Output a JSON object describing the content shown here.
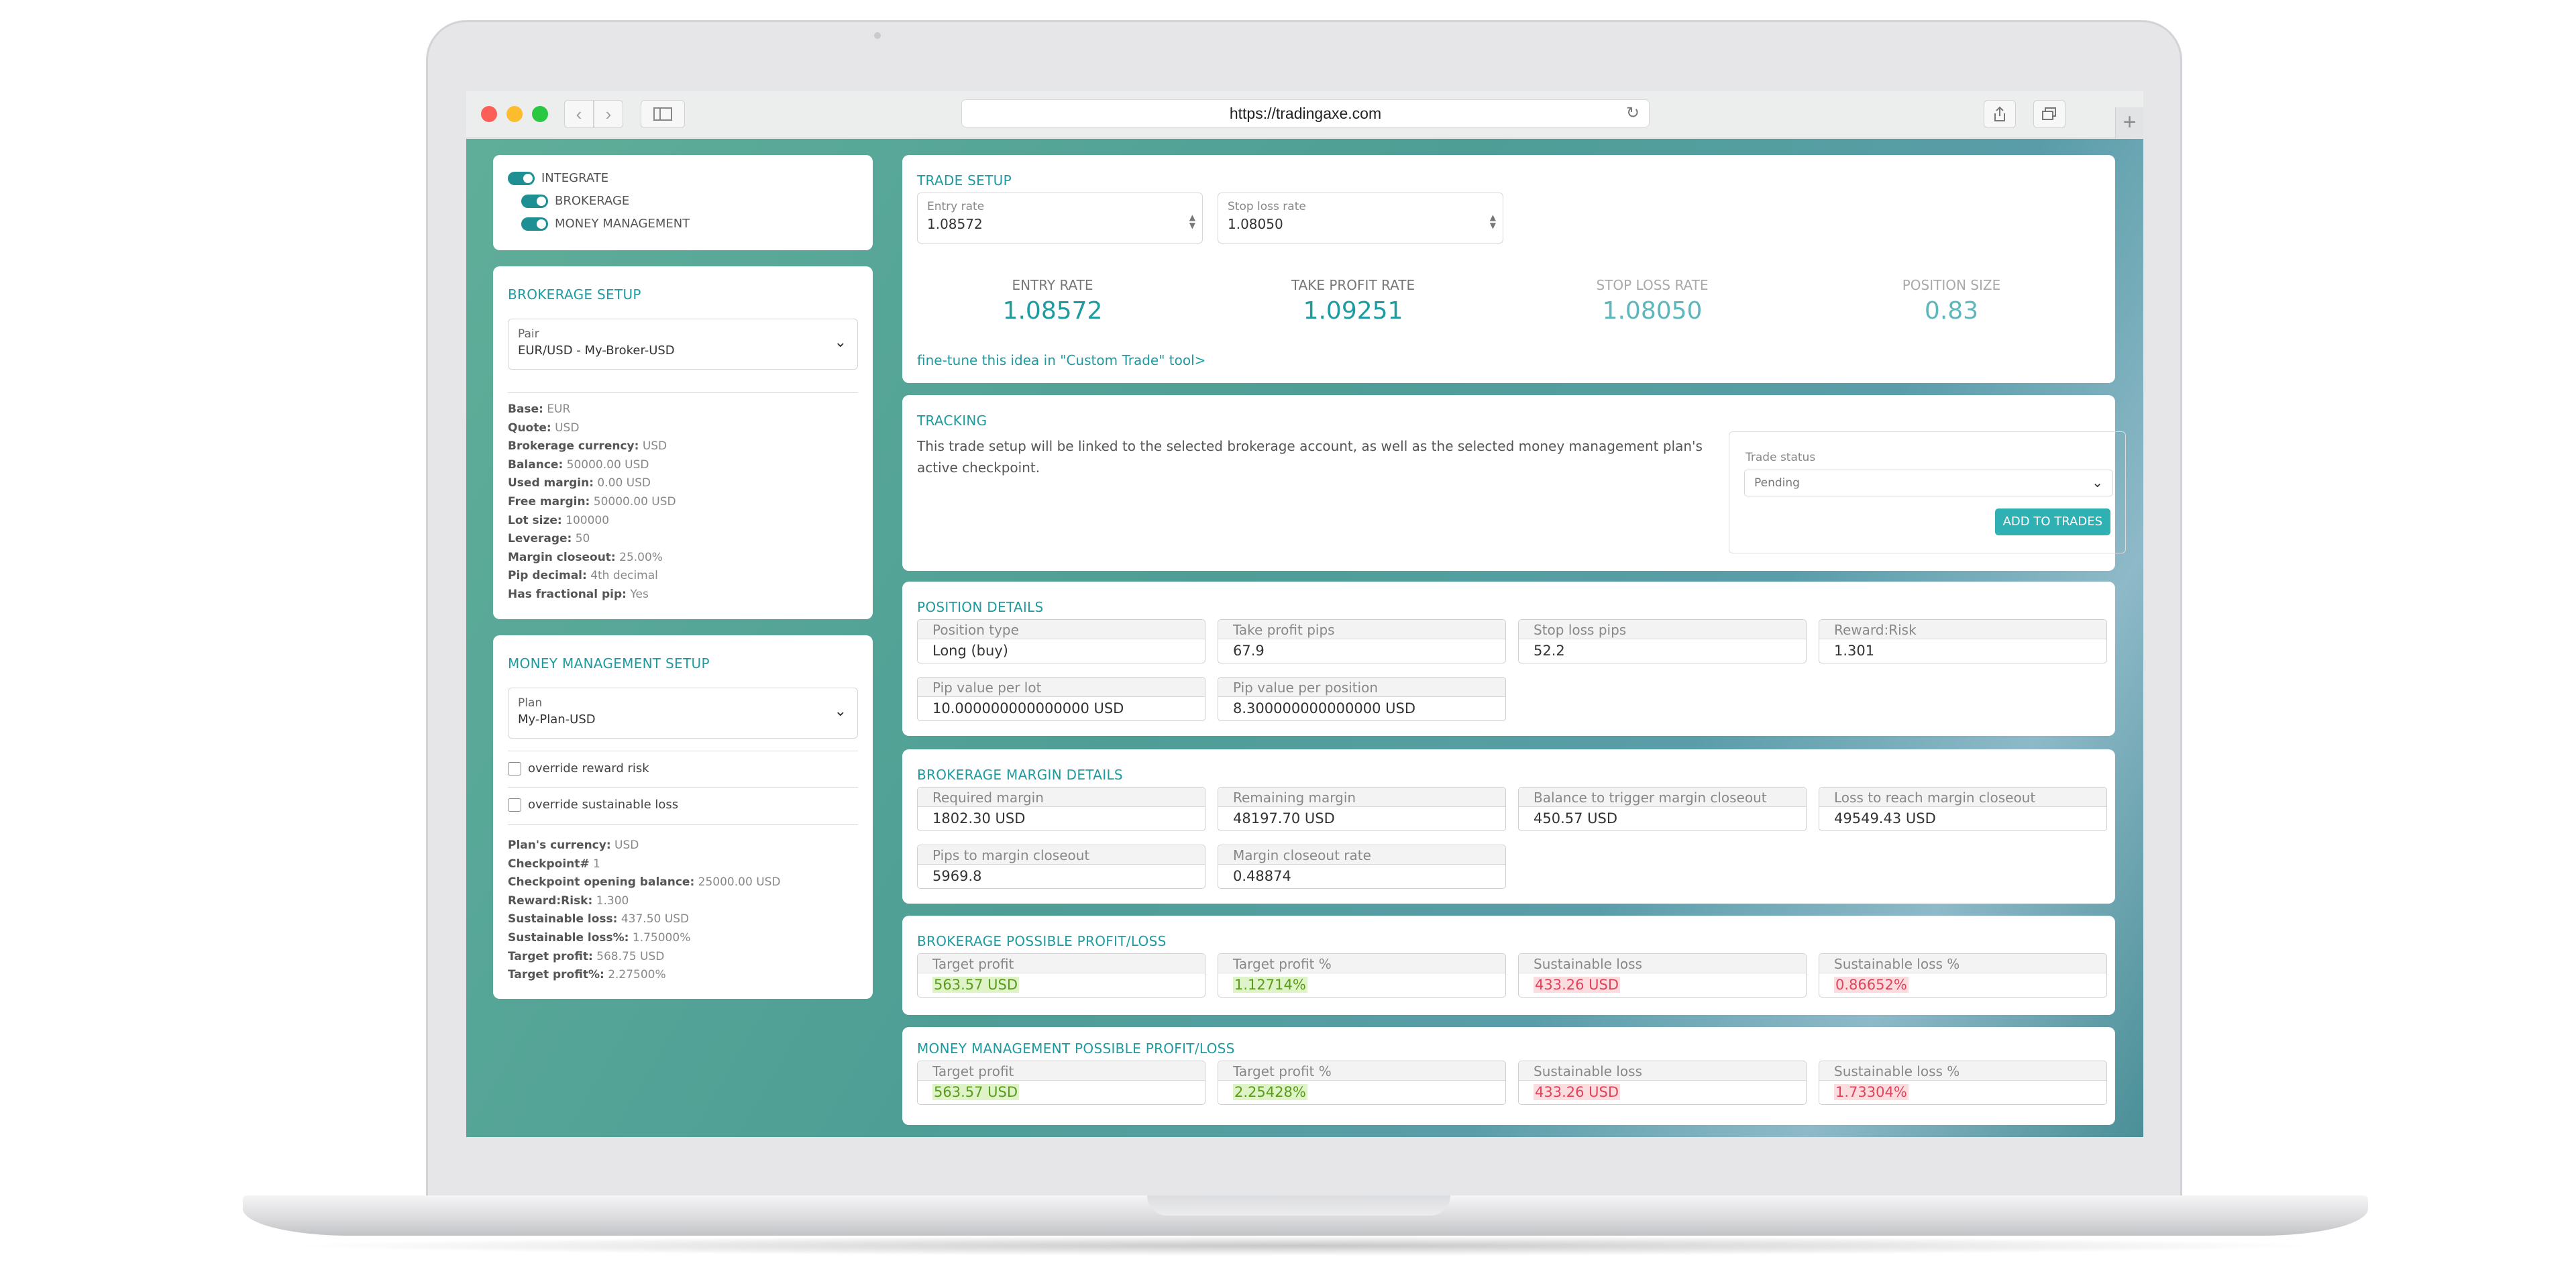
{
  "browser": {
    "url": "https://tradingaxe.com",
    "back_icon": "chevron-left",
    "forward_icon": "chevron-right",
    "new_tab": "+"
  },
  "sidebar": {
    "toggles": [
      {
        "label": "INTEGRATE",
        "on": true
      },
      {
        "label": "BROKERAGE",
        "on": true
      },
      {
        "label": "MONEY MANAGEMENT",
        "on": true
      }
    ],
    "brokerage_setup": {
      "title": "BROKERAGE SETUP",
      "pair_label": "Pair",
      "pair_value": "EUR/USD - My-Broker-USD",
      "details": [
        {
          "k": "Base:",
          "v": "EUR"
        },
        {
          "k": "Quote:",
          "v": "USD"
        },
        {
          "k": "Brokerage currency:",
          "v": "USD"
        },
        {
          "k": "Balance:",
          "v": "50000.00 USD"
        },
        {
          "k": "Used margin:",
          "v": "0.00 USD"
        },
        {
          "k": "Free margin:",
          "v": "50000.00 USD"
        },
        {
          "k": "Lot size:",
          "v": "100000"
        },
        {
          "k": "Leverage:",
          "v": "50"
        },
        {
          "k": "Margin closeout:",
          "v": "25.00%"
        },
        {
          "k": "Pip decimal:",
          "v": "4th decimal"
        },
        {
          "k": "Has fractional pip:",
          "v": "Yes"
        }
      ]
    },
    "money_management_setup": {
      "title": "MONEY MANAGEMENT SETUP",
      "plan_label": "Plan",
      "plan_value": "My-Plan-USD",
      "override_reward_risk": "override reward risk",
      "override_sustainable_loss": "override sustainable loss",
      "details": [
        {
          "k": "Plan's currency:",
          "v": "USD"
        },
        {
          "k": "Checkpoint#",
          "v": "1"
        },
        {
          "k": "Checkpoint opening balance:",
          "v": "25000.00 USD"
        },
        {
          "k": "Reward:Risk:",
          "v": "1.300"
        },
        {
          "k": "Sustainable loss:",
          "v": "437.50 USD"
        },
        {
          "k": "Sustainable loss%:",
          "v": "1.75000%"
        },
        {
          "k": "Target profit:",
          "v": "568.75 USD"
        },
        {
          "k": "Target profit%:",
          "v": "2.27500%"
        }
      ]
    }
  },
  "trade_setup": {
    "title": "TRADE SETUP",
    "entry_label": "Entry rate",
    "entry_value": "1.08572",
    "stop_label": "Stop loss rate",
    "stop_value": "1.08050",
    "stats": [
      {
        "label": "ENTRY RATE",
        "value": "1.08572"
      },
      {
        "label": "TAKE PROFIT RATE",
        "value": "1.09251"
      },
      {
        "label": "STOP LOSS RATE",
        "value": "1.08050"
      },
      {
        "label": "POSITION SIZE",
        "value": "0.83"
      }
    ],
    "link": "fine-tune this idea in \"Custom Trade\" tool>"
  },
  "tracking": {
    "title": "TRACKING",
    "text": "This trade setup will be linked to the selected brokerage account, as well as the selected money management plan's active checkpoint.",
    "status_label": "Trade status",
    "status_value": "Pending",
    "add_button": "ADD TO TRADES"
  },
  "position_details": {
    "title": "POSITION DETAILS",
    "items": [
      {
        "label": "Position type",
        "value": "Long (buy)"
      },
      {
        "label": "Take profit pips",
        "value": "67.9"
      },
      {
        "label": "Stop loss pips",
        "value": "52.2"
      },
      {
        "label": "Reward:Risk",
        "value": "1.301"
      },
      {
        "label": "Pip value per lot",
        "value": "10.000000000000000 USD"
      },
      {
        "label": "Pip value per position",
        "value": "8.300000000000000 USD"
      }
    ]
  },
  "brokerage_margin": {
    "title": "BROKERAGE MARGIN DETAILS",
    "items": [
      {
        "label": "Required margin",
        "value": "1802.30 USD"
      },
      {
        "label": "Remaining margin",
        "value": "48197.70 USD"
      },
      {
        "label": "Balance to trigger margin closeout",
        "value": "450.57 USD"
      },
      {
        "label": "Loss to reach margin closeout",
        "value": "49549.43 USD"
      },
      {
        "label": "Pips to margin closeout",
        "value": "5969.8"
      },
      {
        "label": "Margin closeout rate",
        "value": "0.48874"
      }
    ]
  },
  "brokerage_pl": {
    "title": "BROKERAGE POSSIBLE PROFIT/LOSS",
    "items": [
      {
        "label": "Target profit",
        "value": "563.57 USD"
      },
      {
        "label": "Target profit %",
        "value": "1.12714%"
      },
      {
        "label": "Sustainable loss",
        "value": "433.26 USD"
      },
      {
        "label": "Sustainable loss %",
        "value": "0.86652%"
      }
    ]
  },
  "mm_pl": {
    "title": "MONEY MANAGEMENT POSSIBLE PROFIT/LOSS",
    "items": [
      {
        "label": "Target profit",
        "value": "563.57 USD"
      },
      {
        "label": "Target profit %",
        "value": "2.25428%"
      },
      {
        "label": "Sustainable loss",
        "value": "433.26 USD"
      },
      {
        "label": "Sustainable loss %",
        "value": "1.73304%"
      }
    ]
  },
  "colors": {
    "accent": "#1d9ba0",
    "button": "#2fb0b3",
    "profit": "#5c9b19",
    "loss": "#e0435a"
  }
}
